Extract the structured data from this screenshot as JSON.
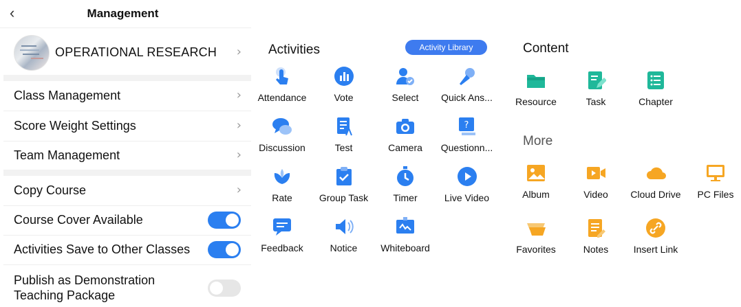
{
  "header": {
    "title": "Management"
  },
  "course": {
    "name": "OPERATIONAL RESEARCH"
  },
  "settings": {
    "class_management": "Class Management",
    "score_weight": "Score Weight Settings",
    "team_management": "Team Management",
    "copy_course": "Copy Course",
    "cover_available": "Course Cover Available",
    "save_to_other": "Activities Save to Other Classes",
    "publish_demo_line1": "Publish as Demonstration",
    "publish_demo_line2": "Teaching Package"
  },
  "toggles": {
    "cover_available": true,
    "save_to_other": true,
    "publish_demo": false
  },
  "activities": {
    "title": "Activities",
    "library_button": "Activity Library",
    "items": [
      {
        "label": "Attendance",
        "icon": "tap-hand-icon"
      },
      {
        "label": "Vote",
        "icon": "bar-chart-circle-icon"
      },
      {
        "label": "Select",
        "icon": "user-check-icon"
      },
      {
        "label": "Quick Ans...",
        "icon": "microphone-icon"
      },
      {
        "label": "Discussion",
        "icon": "chat-bubbles-icon"
      },
      {
        "label": "Test",
        "icon": "test-paper-icon"
      },
      {
        "label": "Camera",
        "icon": "camera-icon"
      },
      {
        "label": "Questionn...",
        "icon": "questionnaire-icon"
      },
      {
        "label": "Rate",
        "icon": "lotus-icon"
      },
      {
        "label": "Group Task",
        "icon": "clipboard-check-icon"
      },
      {
        "label": "Timer",
        "icon": "stopwatch-icon"
      },
      {
        "label": "Live Video",
        "icon": "play-circle-icon"
      },
      {
        "label": "Feedback",
        "icon": "feedback-icon"
      },
      {
        "label": "Notice",
        "icon": "speaker-icon"
      },
      {
        "label": "Whiteboard",
        "icon": "whiteboard-icon"
      }
    ]
  },
  "content": {
    "title": "Content",
    "items": [
      {
        "label": "Resource",
        "icon": "folder-icon"
      },
      {
        "label": "Task",
        "icon": "task-edit-icon"
      },
      {
        "label": "Chapter",
        "icon": "list-icon"
      }
    ]
  },
  "more": {
    "title": "More",
    "items": [
      {
        "label": "Album",
        "icon": "image-icon"
      },
      {
        "label": "Video",
        "icon": "video-camera-icon"
      },
      {
        "label": "Cloud Drive",
        "icon": "cloud-icon"
      },
      {
        "label": "PC Files",
        "icon": "monitor-icon"
      },
      {
        "label": "Favorites",
        "icon": "favorites-icon"
      },
      {
        "label": "Notes",
        "icon": "notes-icon"
      },
      {
        "label": "Insert Link",
        "icon": "link-icon"
      }
    ]
  },
  "colors": {
    "accent": "#2b7ff0",
    "teal": "#1fb89a",
    "orange": "#f6a623"
  }
}
